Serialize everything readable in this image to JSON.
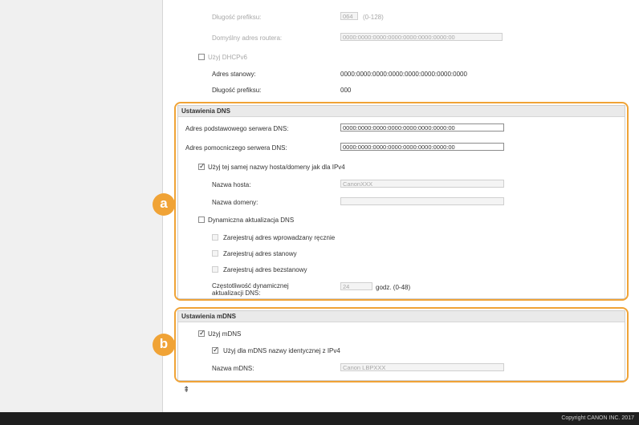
{
  "ipv6": {
    "prefix_length_label": "Długość prefiksu:",
    "prefix_length_value": "064",
    "prefix_length_range": "(0-128)",
    "default_router_label": "Domyślny adres routera:",
    "default_router_value": "0000:0000:0000:0000:0000:0000:0000:00",
    "use_dhcpv6_label": "Użyj DHCPv6",
    "stateful_address_label": "Adres stanowy:",
    "stateful_address_value": "0000:0000:0000:0000:0000:0000:0000:0000",
    "prefix_length2_label": "Długość prefiksu:",
    "prefix_length2_value": "000"
  },
  "dns": {
    "title": "Ustawienia DNS",
    "primary_label": "Adres podstawowego serwera DNS:",
    "primary_value": "0000:0000:0000:0000:0000:0000:0000:00",
    "secondary_label": "Adres pomocniczego serwera DNS:",
    "secondary_value": "0000:0000:0000:0000:0000:0000:0000:00",
    "same_name_label": "Użyj tej samej nazwy hosta/domeny jak dla IPv4",
    "host_name_label": "Nazwa hosta:",
    "host_name_value": "CanonXXX",
    "domain_name_label": "Nazwa domeny:",
    "domain_name_value": "",
    "dynamic_update_label": "Dynamiczna aktualizacja DNS",
    "register_manual_label": "Zarejestruj adres wprowadzany ręcznie",
    "register_stateful_label": "Zarejestruj adres stanowy",
    "register_stateless_label": "Zarejestruj adres bezstanowy",
    "interval_label_line1": "Częstotliwość dynamicznej",
    "interval_label_line2": "aktualizacji DNS:",
    "interval_value": "24",
    "interval_unit": "godz. (0-48)"
  },
  "mdns": {
    "title": "Ustawienia mDNS",
    "use_mdns_label": "Użyj mDNS",
    "same_as_ipv4_label": "Użyj dla mDNS nazwy identycznej z IPv4",
    "mdns_name_label": "Nazwa mDNS:",
    "mdns_name_value": "Canon LBPXXX"
  },
  "badges": {
    "a": "a",
    "b": "b"
  },
  "to_top_glyph": "⇞",
  "footer": {
    "copyright": "Copyright CANON INC. 2017"
  },
  "colors": {
    "highlight": "#f0a336"
  }
}
